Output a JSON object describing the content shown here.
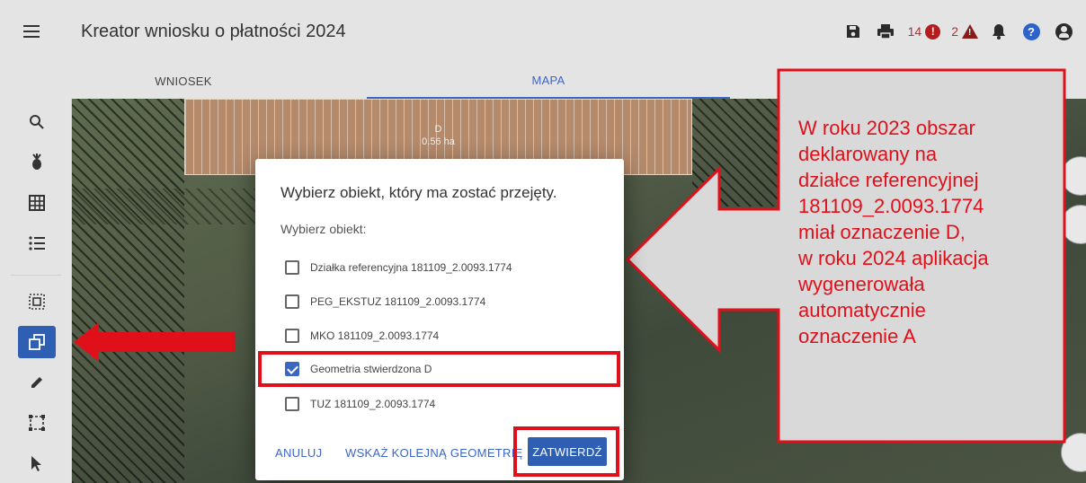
{
  "header": {
    "title": "Kreator wniosku o płatności 2024",
    "errors_count": "14",
    "warnings_count": "2",
    "error_badge": "!",
    "warning_badge": "!",
    "help_badge": "?"
  },
  "tabs": [
    {
      "label": "WNIOSEK"
    },
    {
      "label": "MAPA"
    }
  ],
  "map": {
    "parcel_label": "D",
    "parcel_area": "0.56 ha"
  },
  "dialog": {
    "title": "Wybierz obiekt, który ma zostać przejęty.",
    "subtitle": "Wybierz obiekt:",
    "options": [
      {
        "label": "Działka referencyjna 181109_2.0093.1774",
        "checked": false
      },
      {
        "label": "PEG_EKSTUZ 181109_2.0093.1774",
        "checked": false
      },
      {
        "label": "MKO 181109_2.0093.1774",
        "checked": false
      },
      {
        "label": "Geometria stwierdzona D",
        "checked": true
      },
      {
        "label": "TUZ 181109_2.0093.1774",
        "checked": false
      }
    ],
    "cancel_label": "ANULUJ",
    "next_geometry_label": "WSKAŻ KOLEJNĄ GEOMETRIĘ",
    "confirm_label": "ZATWIERDŹ"
  },
  "annotation": {
    "lines": [
      "W roku 2023 obszar",
      "deklarowany na",
      "działce referencyjnej",
      "181109_2.0093.1774",
      "miał oznaczenie D,",
      "w roku 2024 aplikacja",
      "wygenerowała",
      "automatycznie",
      "oznaczenie A"
    ]
  },
  "colors": {
    "accent": "#3b66c4",
    "annotation_red": "#e0101a",
    "callout_fill": "#d9d9d9"
  }
}
